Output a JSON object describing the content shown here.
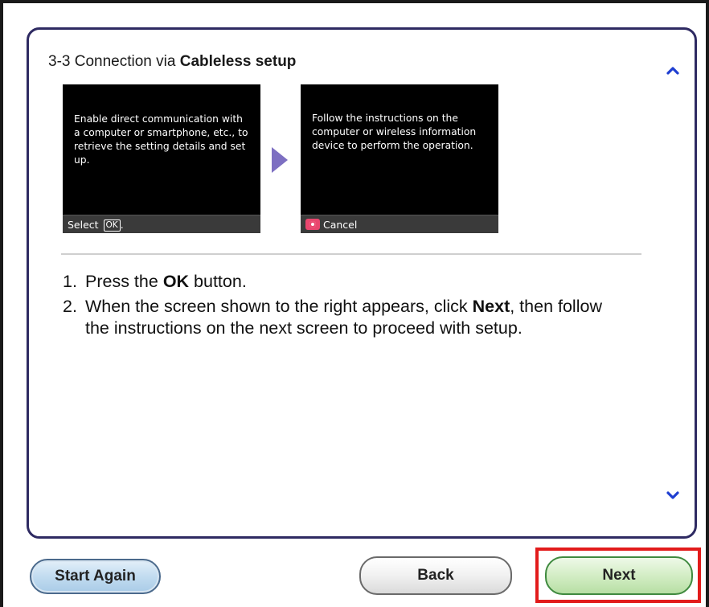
{
  "section": {
    "number": "3-3",
    "title_prefix": "Connection via",
    "title_bold": "Cableless setup"
  },
  "screens": [
    {
      "message": "Enable direct communication with a computer or smartphone, etc., to retrieve the setting details and set up.",
      "footer_prefix": "Select",
      "footer_key": "OK",
      "footer_suffix": "."
    },
    {
      "message": "Follow the instructions on the computer or wireless information device to perform the operation.",
      "footer_label": "Cancel"
    }
  ],
  "instructions": [
    {
      "number": "1.",
      "text_a": "Press the",
      "bold": "OK",
      "text_b": "button."
    },
    {
      "number": "2.",
      "text_a": "When the screen shown to the right appears, click",
      "bold": "Next",
      "text_b": ", then follow the instructions on the next screen to proceed with setup."
    }
  ],
  "buttons": {
    "start_again": "Start Again",
    "back": "Back",
    "next": "Next"
  },
  "icons": {
    "scroll_up": "chevron-up-icon",
    "scroll_down": "chevron-down-icon",
    "step_arrow": "arrow-right-icon",
    "stop": "stop-button-icon"
  },
  "colors": {
    "panel_border": "#2e2a62",
    "arrow": "#7d6fc2",
    "scroll_icon": "#1f3fd1",
    "highlight": "#e21b1b",
    "stop_key": "#e9466e"
  }
}
